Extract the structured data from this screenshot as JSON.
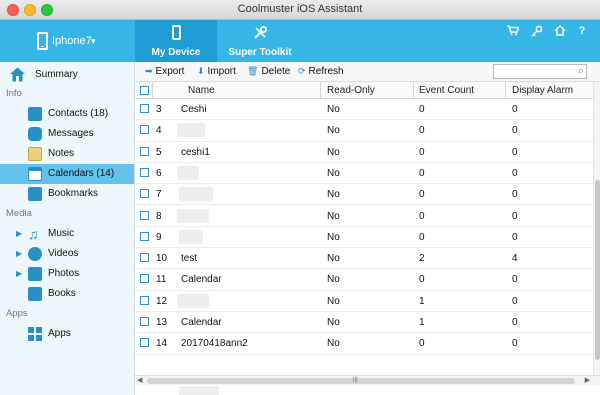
{
  "window": {
    "title": "Coolmuster iOS Assistant"
  },
  "header": {
    "device_name": "Iphone7",
    "tabs": [
      {
        "label": "My Device",
        "icon": "phone-icon"
      },
      {
        "label": "Super Toolkit",
        "icon": "tools-icon"
      }
    ],
    "right_icons": [
      "cart-icon",
      "key-icon",
      "home-icon",
      "help-icon"
    ],
    "help_glyph": "?"
  },
  "sidebar": {
    "summary": "Summary",
    "sections": {
      "info": "Info",
      "media": "Media",
      "apps": "Apps"
    },
    "items": [
      {
        "label": "Contacts  (18)",
        "icon": "contacts-icon"
      },
      {
        "label": "Messages",
        "icon": "messages-icon"
      },
      {
        "label": "Notes",
        "icon": "notes-icon"
      },
      {
        "label": "Calendars  (14)",
        "icon": "calendar-icon",
        "selected": true
      },
      {
        "label": "Bookmarks",
        "icon": "bookmark-icon"
      },
      {
        "label": "Music",
        "icon": "music-icon"
      },
      {
        "label": "Videos",
        "icon": "videos-icon"
      },
      {
        "label": "Photos",
        "icon": "photos-icon"
      },
      {
        "label": "Books",
        "icon": "books-icon"
      },
      {
        "label": "Apps",
        "icon": "apps-icon"
      }
    ]
  },
  "toolbar": {
    "export": "Export",
    "import": "Import",
    "delete": "Delete",
    "refresh": "Refresh",
    "search_placeholder": ""
  },
  "table": {
    "columns": [
      "Name",
      "Read-Only",
      "Event Count",
      "Display Alarm"
    ],
    "rows": [
      {
        "num": "3",
        "name": "Ceshi",
        "read_only": "No",
        "event_count": "0",
        "display_alarm": "0"
      },
      {
        "num": "4",
        "name": "",
        "read_only": "No",
        "event_count": "0",
        "display_alarm": "0"
      },
      {
        "num": "5",
        "name": "ceshi1",
        "read_only": "No",
        "event_count": "0",
        "display_alarm": "0"
      },
      {
        "num": "6",
        "name": "",
        "read_only": "No",
        "event_count": "0",
        "display_alarm": "0"
      },
      {
        "num": "7",
        "name": "",
        "read_only": "No",
        "event_count": "0",
        "display_alarm": "0"
      },
      {
        "num": "8",
        "name": "",
        "read_only": "No",
        "event_count": "0",
        "display_alarm": "0"
      },
      {
        "num": "9",
        "name": "",
        "read_only": "No",
        "event_count": "0",
        "display_alarm": "0"
      },
      {
        "num": "10",
        "name": "test",
        "read_only": "No",
        "event_count": "2",
        "display_alarm": "4"
      },
      {
        "num": "11",
        "name": "Calendar",
        "read_only": "No",
        "event_count": "0",
        "display_alarm": "0"
      },
      {
        "num": "12",
        "name": "",
        "read_only": "No",
        "event_count": "1",
        "display_alarm": "0"
      },
      {
        "num": "13",
        "name": "Calendar",
        "read_only": "No",
        "event_count": "1",
        "display_alarm": "0"
      },
      {
        "num": "14",
        "name": "20170418ann2",
        "read_only": "No",
        "event_count": "0",
        "display_alarm": "0"
      }
    ]
  },
  "colors": {
    "accent": "#35b6e7",
    "active_tab": "#1e9dd4",
    "selected_item": "#63c3ec",
    "sidebar_bg": "#eef7fc"
  }
}
